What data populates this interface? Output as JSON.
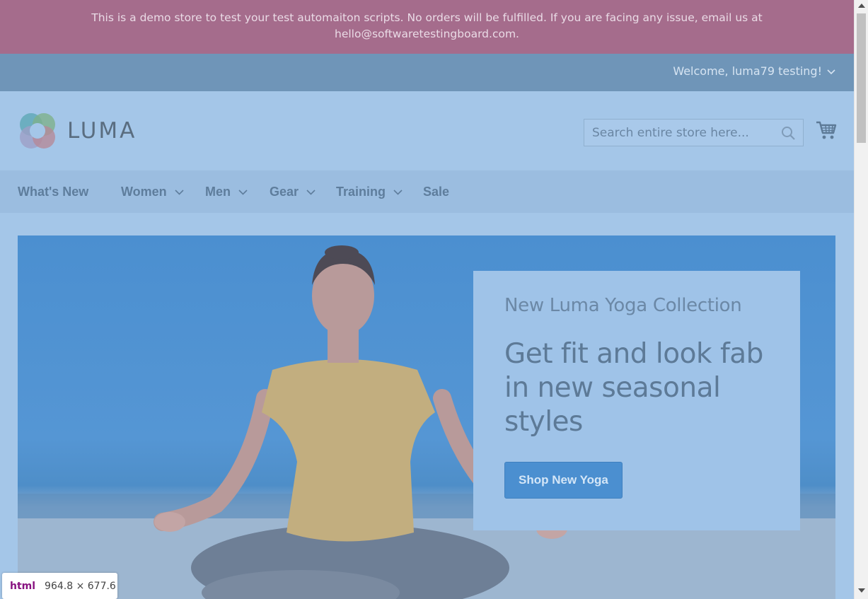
{
  "demo_notice": {
    "line1": "This is a demo store to test your test automaiton scripts. No orders will be fulfilled. If you are facing any issue, email us at",
    "line2": "hello@softwaretestingboard.com."
  },
  "panel": {
    "welcome": "Welcome, luma79 testing!",
    "welcome_icon": "chevron-down-icon"
  },
  "header": {
    "logo_text": "LUMA",
    "search_placeholder": "Search entire store here...",
    "search_icon": "search-icon",
    "cart_icon": "cart-icon"
  },
  "nav": {
    "items": [
      {
        "label": "What's New",
        "has_dropdown": false
      },
      {
        "label": "Women",
        "has_dropdown": true
      },
      {
        "label": "Men",
        "has_dropdown": true
      },
      {
        "label": "Gear",
        "has_dropdown": true
      },
      {
        "label": "Training",
        "has_dropdown": true
      },
      {
        "label": "Sale",
        "has_dropdown": false
      }
    ]
  },
  "hero": {
    "subtitle": "New Luma Yoga Collection",
    "title_line1": "Get fit and look fab",
    "title_line2": "in new seasonal",
    "title_line3": "styles",
    "button": "Shop New Yoga"
  },
  "inspector_tooltip": {
    "tag": "html",
    "dimensions": "964.8 × 677.6"
  },
  "colors": {
    "notice_bg": "#a56c8c",
    "panel_bg": "#6f95b8",
    "page_bg": "#a4c6e8",
    "button_bg": "#4b8fd0"
  }
}
